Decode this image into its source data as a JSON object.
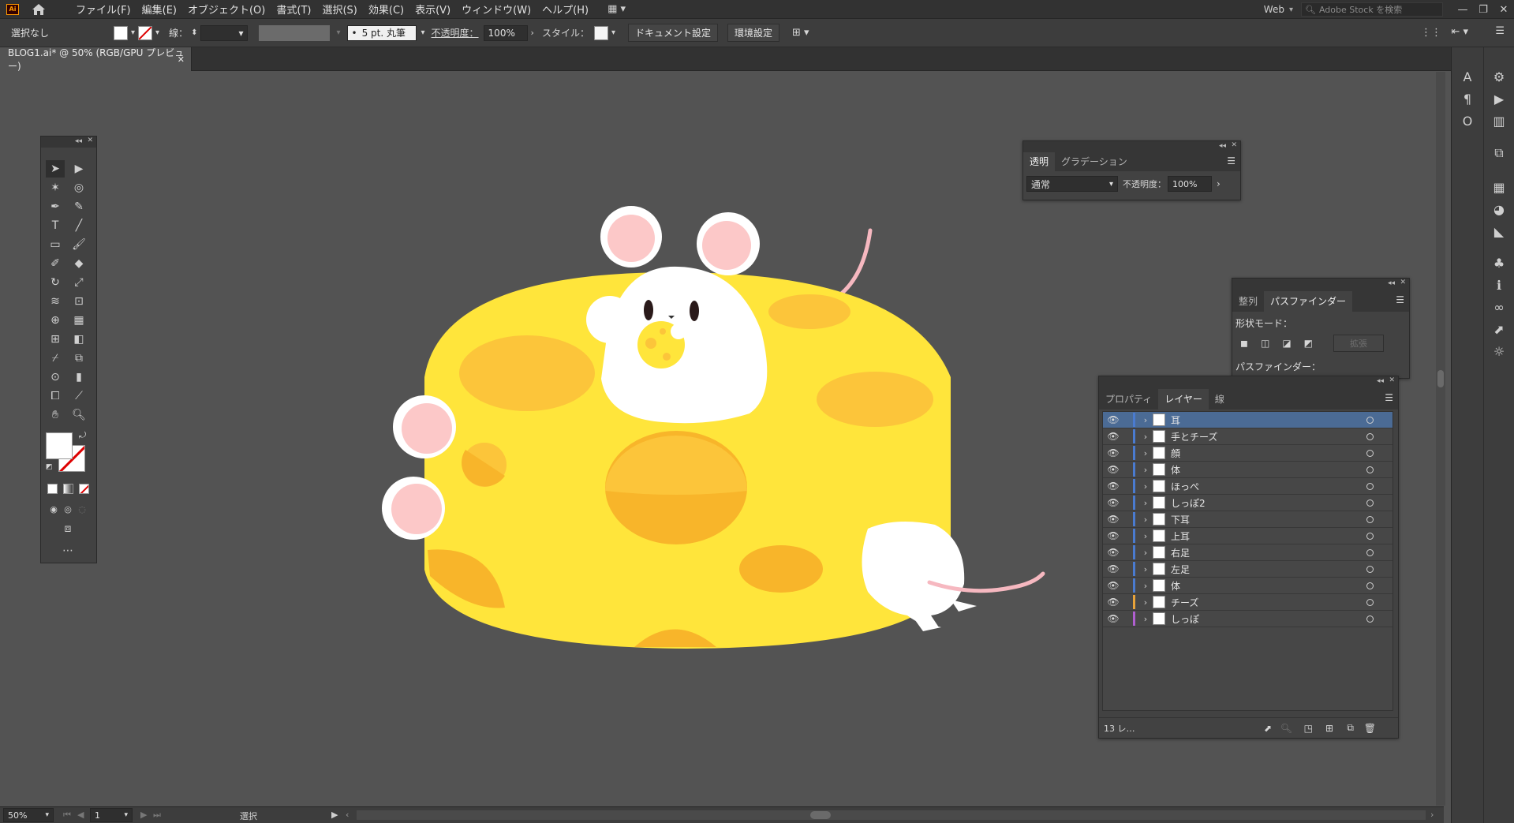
{
  "app": {
    "logo_text": "Ai"
  },
  "menu": [
    "ファイル(F)",
    "編集(E)",
    "オブジェクト(O)",
    "書式(T)",
    "選択(S)",
    "効果(C)",
    "表示(V)",
    "ウィンドウ(W)",
    "ヘルプ(H)"
  ],
  "workspace": "Web",
  "search_placeholder": "Adobe Stock を検索",
  "control": {
    "selection": "選択なし",
    "stroke_label": "線：",
    "brush": "5 pt. 丸筆",
    "opacity_label": "不透明度：",
    "opacity_value": "100%",
    "style_label": "スタイル：",
    "doc_setup": "ドキュメント設定",
    "prefs": "環境設定"
  },
  "document_tab": "BLOG1.ai* @ 50% (RGB/GPU プレビュー)",
  "status": {
    "zoom": "50%",
    "page": "1",
    "mode": "選択"
  },
  "transparency_panel": {
    "tabs": [
      "透明",
      "グラデーション"
    ],
    "blend_mode": "通常",
    "opacity_label": "不透明度：",
    "opacity_value": "100%"
  },
  "pathfinder_panel": {
    "tabs": [
      "整列",
      "パスファインダー"
    ],
    "shape_modes_label": "形状モード：",
    "expand_label": "拡張",
    "pathfinders_label": "パスファインダー："
  },
  "layers_panel": {
    "tabs": [
      "プロパティ",
      "レイヤー",
      "線"
    ],
    "layers": [
      {
        "name": "耳",
        "color": "#4a7bd0"
      },
      {
        "name": "手とチーズ",
        "color": "#4a7bd0"
      },
      {
        "name": "顔",
        "color": "#4a7bd0"
      },
      {
        "name": "体",
        "color": "#4a7bd0"
      },
      {
        "name": "ほっぺ",
        "color": "#4a7bd0"
      },
      {
        "name": "しっぽ2",
        "color": "#4a7bd0"
      },
      {
        "name": "下耳",
        "color": "#4a7bd0"
      },
      {
        "name": "上耳",
        "color": "#4a7bd0"
      },
      {
        "name": "右足",
        "color": "#4a7bd0"
      },
      {
        "name": "左足",
        "color": "#4a7bd0"
      },
      {
        "name": "体",
        "color": "#4a7bd0"
      },
      {
        "name": "チーズ",
        "color": "#e8a33a"
      },
      {
        "name": "しっぽ",
        "color": "#b05fd0"
      }
    ],
    "footer_count": "13 レ…"
  },
  "colors": {
    "cheese": "#ffe53b",
    "cheese_hole": "#fcc53a",
    "cheese_hole_dark": "#f8b52a",
    "ear_inner": "#fcc8c8",
    "tail": "#f6b8c0",
    "selected_layer": "#4b6b95"
  }
}
